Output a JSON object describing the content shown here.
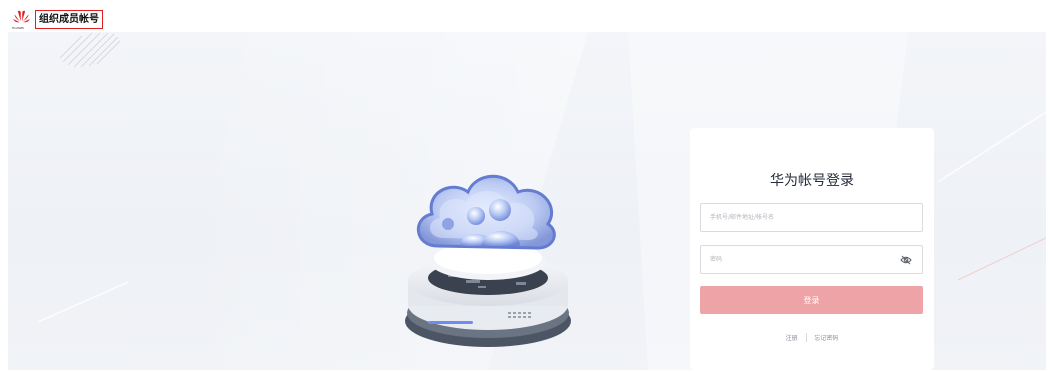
{
  "header": {
    "brand_name": "HUAWEI",
    "tenant_label": "组织成员帐号",
    "brand_color": "#e02020"
  },
  "login": {
    "title": "华为帐号登录",
    "account_placeholder": "手机号/邮件地址/帐号名",
    "password_placeholder": "密码",
    "show_password_icon": "eye-off-icon",
    "submit_label": "登录",
    "submit_color": "#eea3a6",
    "register_link": "注册",
    "forgot_link": "忘记密码"
  }
}
